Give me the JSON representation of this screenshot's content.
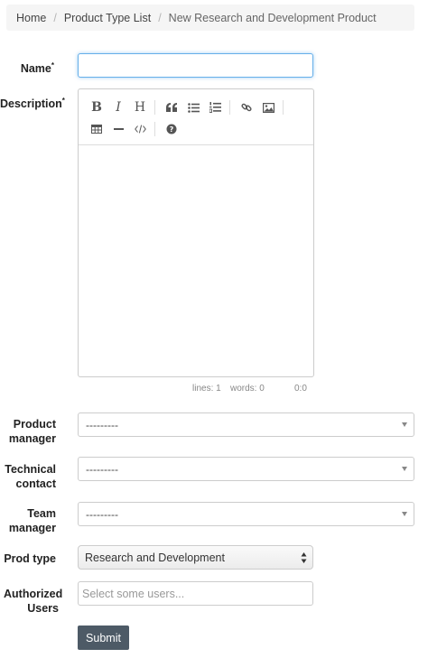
{
  "breadcrumb": {
    "home": "Home",
    "list": "Product Type List",
    "current": "New Research and Development Product",
    "separator": "/"
  },
  "form": {
    "name": {
      "label": "Name",
      "required_mark": "*",
      "value": ""
    },
    "description": {
      "label": "Description",
      "required_mark": "*",
      "toolbar": {
        "bold": "B",
        "italic": "I",
        "heading": "H",
        "icons": [
          "quote-icon",
          "unordered-list-icon",
          "ordered-list-icon",
          "link-icon",
          "image-icon",
          "table-icon",
          "horizontal-rule-icon",
          "code-icon",
          "help-icon"
        ]
      },
      "status": {
        "lines": "lines: 1",
        "words": "words: 0",
        "cursor": "0:0"
      }
    },
    "product_manager": {
      "label_1": "Product",
      "label_2": "manager",
      "value": "---------"
    },
    "technical_contact": {
      "label_1": "Technical",
      "label_2": "contact",
      "value": "---------"
    },
    "team_manager": {
      "label_1": "Team",
      "label_2": "manager",
      "value": "---------"
    },
    "prod_type": {
      "label": "Prod type",
      "value": "Research and Development"
    },
    "authorized_users": {
      "label_1": "Authorized",
      "label_2": "Users",
      "placeholder": "Select some users..."
    },
    "submit_label": "Submit"
  },
  "colors": {
    "focus_border": "#66afe9",
    "submit_bg": "#4d5a66",
    "breadcrumb_bg": "#f5f5f5"
  }
}
